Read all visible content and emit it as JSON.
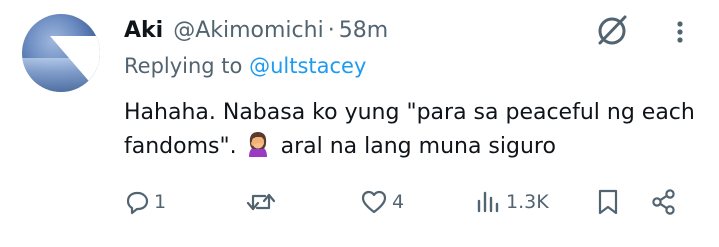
{
  "tweet": {
    "author_name": "Aki",
    "author_handle": "@Akimomichi",
    "separator": "·",
    "time_ago": "58m",
    "replying_prefix": "Replying to",
    "replying_to": "@ultstacey",
    "text_part1": "Hahaha. Nabasa ko yung \"para sa peaceful ng each fandoms\".",
    "emoji": "woman-facepalming",
    "text_part2": "aral na lang muna siguro"
  },
  "actions": {
    "reply_count": "1",
    "repost_count": "",
    "like_count": "4",
    "views_count": "1.3K"
  },
  "colors": {
    "text_primary": "#0f1419",
    "text_secondary": "#536471",
    "link": "#1d9bf0"
  }
}
